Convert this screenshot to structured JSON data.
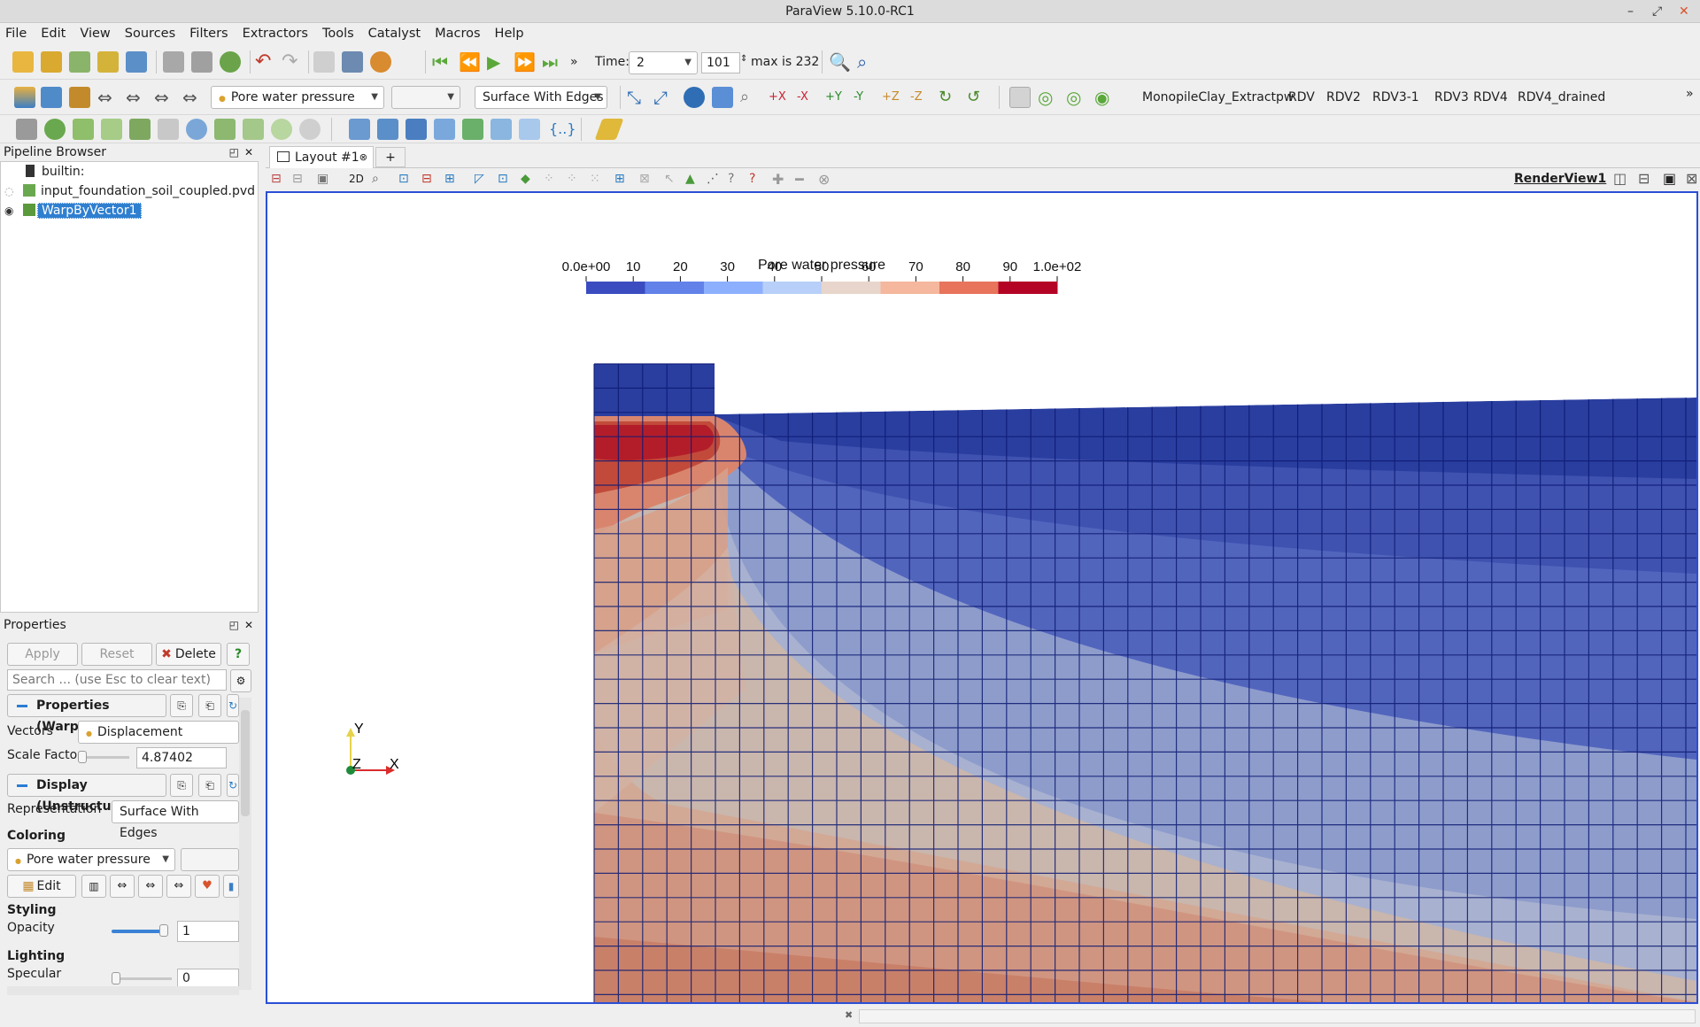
{
  "window": {
    "title": "ParaView 5.10.0-RC1"
  },
  "menu": [
    "File",
    "Edit",
    "View",
    "Sources",
    "Filters",
    "Extractors",
    "Tools",
    "Catalyst",
    "Macros",
    "Help"
  ],
  "time": {
    "label": "Time:",
    "value": "2",
    "step": "101",
    "max_text": "max is 232"
  },
  "toolbar2": {
    "color_array": "Pore water pressure",
    "representation": "Surface With Edges",
    "macros": [
      "MonopileClay_Extractpw",
      "RDV",
      "RDV2",
      "RDV3-1",
      "RDV3",
      "RDV4",
      "RDV4_drained"
    ]
  },
  "pipeline": {
    "title": "Pipeline Browser",
    "items": [
      "builtin:",
      "input_foundation_soil_coupled.pvd",
      "WarpByVector1"
    ]
  },
  "properties": {
    "title": "Properties",
    "apply": "Apply",
    "reset": "Reset",
    "delete": "Delete",
    "help": "?",
    "search_placeholder": "Search ... (use Esc to clear text)",
    "section1": "Properties (WarpBy",
    "vectors_label": "Vectors",
    "vectors_value": "Displacement",
    "scale_label": "Scale Factor",
    "scale_value": "4.87402",
    "section2": "Display (Unstructur",
    "repr_label": "Representation",
    "repr_value": "Surface With Edges",
    "coloring": "Coloring",
    "color_value": "Pore water pressure",
    "edit": "Edit",
    "styling": "Styling",
    "opacity_label": "Opacity",
    "opacity_value": "1",
    "lighting": "Lighting",
    "specular_label": "Specular",
    "specular_value": "0"
  },
  "layout": {
    "tab": "Layout #1",
    "add": "+",
    "view_name": "RenderView1",
    "mode2d": "2D"
  },
  "legend": {
    "title": "Pore water pressure",
    "ticks": [
      "0.0e+00",
      "10",
      "20",
      "30",
      "40",
      "50",
      "60",
      "70",
      "80",
      "90",
      "1.0e+02"
    ],
    "range": [
      0,
      100
    ],
    "colors": [
      "#3b4cc0",
      "#6282ea",
      "#8db0fe",
      "#b8d0f9",
      "#e8d6cc",
      "#f5b79d",
      "#e7745b",
      "#b40426"
    ]
  },
  "axes": {
    "y": "Y",
    "z": "Z",
    "x": "X"
  }
}
